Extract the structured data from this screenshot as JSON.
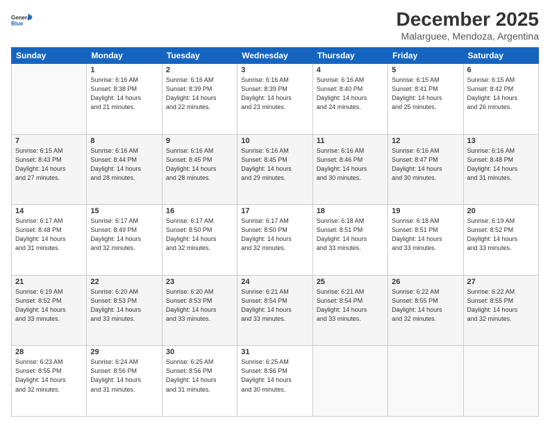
{
  "logo": {
    "line1": "General",
    "line2": "Blue"
  },
  "title": "December 2025",
  "subtitle": "Malarguee, Mendoza, Argentina",
  "days_of_week": [
    "Sunday",
    "Monday",
    "Tuesday",
    "Wednesday",
    "Thursday",
    "Friday",
    "Saturday"
  ],
  "weeks": [
    [
      {
        "num": "",
        "info": ""
      },
      {
        "num": "1",
        "info": "Sunrise: 6:16 AM\nSunset: 8:38 PM\nDaylight: 14 hours\nand 21 minutes."
      },
      {
        "num": "2",
        "info": "Sunrise: 6:16 AM\nSunset: 8:39 PM\nDaylight: 14 hours\nand 22 minutes."
      },
      {
        "num": "3",
        "info": "Sunrise: 6:16 AM\nSunset: 8:39 PM\nDaylight: 14 hours\nand 23 minutes."
      },
      {
        "num": "4",
        "info": "Sunrise: 6:16 AM\nSunset: 8:40 PM\nDaylight: 14 hours\nand 24 minutes."
      },
      {
        "num": "5",
        "info": "Sunrise: 6:15 AM\nSunset: 8:41 PM\nDaylight: 14 hours\nand 25 minutes."
      },
      {
        "num": "6",
        "info": "Sunrise: 6:15 AM\nSunset: 8:42 PM\nDaylight: 14 hours\nand 26 minutes."
      }
    ],
    [
      {
        "num": "7",
        "info": "Sunrise: 6:15 AM\nSunset: 8:43 PM\nDaylight: 14 hours\nand 27 minutes."
      },
      {
        "num": "8",
        "info": "Sunrise: 6:16 AM\nSunset: 8:44 PM\nDaylight: 14 hours\nand 28 minutes."
      },
      {
        "num": "9",
        "info": "Sunrise: 6:16 AM\nSunset: 8:45 PM\nDaylight: 14 hours\nand 28 minutes."
      },
      {
        "num": "10",
        "info": "Sunrise: 6:16 AM\nSunset: 8:45 PM\nDaylight: 14 hours\nand 29 minutes."
      },
      {
        "num": "11",
        "info": "Sunrise: 6:16 AM\nSunset: 8:46 PM\nDaylight: 14 hours\nand 30 minutes."
      },
      {
        "num": "12",
        "info": "Sunrise: 6:16 AM\nSunset: 8:47 PM\nDaylight: 14 hours\nand 30 minutes."
      },
      {
        "num": "13",
        "info": "Sunrise: 6:16 AM\nSunset: 8:48 PM\nDaylight: 14 hours\nand 31 minutes."
      }
    ],
    [
      {
        "num": "14",
        "info": "Sunrise: 6:17 AM\nSunset: 8:48 PM\nDaylight: 14 hours\nand 31 minutes."
      },
      {
        "num": "15",
        "info": "Sunrise: 6:17 AM\nSunset: 8:49 PM\nDaylight: 14 hours\nand 32 minutes."
      },
      {
        "num": "16",
        "info": "Sunrise: 6:17 AM\nSunset: 8:50 PM\nDaylight: 14 hours\nand 32 minutes."
      },
      {
        "num": "17",
        "info": "Sunrise: 6:17 AM\nSunset: 8:50 PM\nDaylight: 14 hours\nand 32 minutes."
      },
      {
        "num": "18",
        "info": "Sunrise: 6:18 AM\nSunset: 8:51 PM\nDaylight: 14 hours\nand 33 minutes."
      },
      {
        "num": "19",
        "info": "Sunrise: 6:18 AM\nSunset: 8:51 PM\nDaylight: 14 hours\nand 33 minutes."
      },
      {
        "num": "20",
        "info": "Sunrise: 6:19 AM\nSunset: 8:52 PM\nDaylight: 14 hours\nand 33 minutes."
      }
    ],
    [
      {
        "num": "21",
        "info": "Sunrise: 6:19 AM\nSunset: 8:52 PM\nDaylight: 14 hours\nand 33 minutes."
      },
      {
        "num": "22",
        "info": "Sunrise: 6:20 AM\nSunset: 8:53 PM\nDaylight: 14 hours\nand 33 minutes."
      },
      {
        "num": "23",
        "info": "Sunrise: 6:20 AM\nSunset: 8:53 PM\nDaylight: 14 hours\nand 33 minutes."
      },
      {
        "num": "24",
        "info": "Sunrise: 6:21 AM\nSunset: 8:54 PM\nDaylight: 14 hours\nand 33 minutes."
      },
      {
        "num": "25",
        "info": "Sunrise: 6:21 AM\nSunset: 8:54 PM\nDaylight: 14 hours\nand 33 minutes."
      },
      {
        "num": "26",
        "info": "Sunrise: 6:22 AM\nSunset: 8:55 PM\nDaylight: 14 hours\nand 32 minutes."
      },
      {
        "num": "27",
        "info": "Sunrise: 6:22 AM\nSunset: 8:55 PM\nDaylight: 14 hours\nand 32 minutes."
      }
    ],
    [
      {
        "num": "28",
        "info": "Sunrise: 6:23 AM\nSunset: 8:55 PM\nDaylight: 14 hours\nand 32 minutes."
      },
      {
        "num": "29",
        "info": "Sunrise: 6:24 AM\nSunset: 8:56 PM\nDaylight: 14 hours\nand 31 minutes."
      },
      {
        "num": "30",
        "info": "Sunrise: 6:25 AM\nSunset: 8:56 PM\nDaylight: 14 hours\nand 31 minutes."
      },
      {
        "num": "31",
        "info": "Sunrise: 6:25 AM\nSunset: 8:56 PM\nDaylight: 14 hours\nand 30 minutes."
      },
      {
        "num": "",
        "info": ""
      },
      {
        "num": "",
        "info": ""
      },
      {
        "num": "",
        "info": ""
      }
    ]
  ]
}
